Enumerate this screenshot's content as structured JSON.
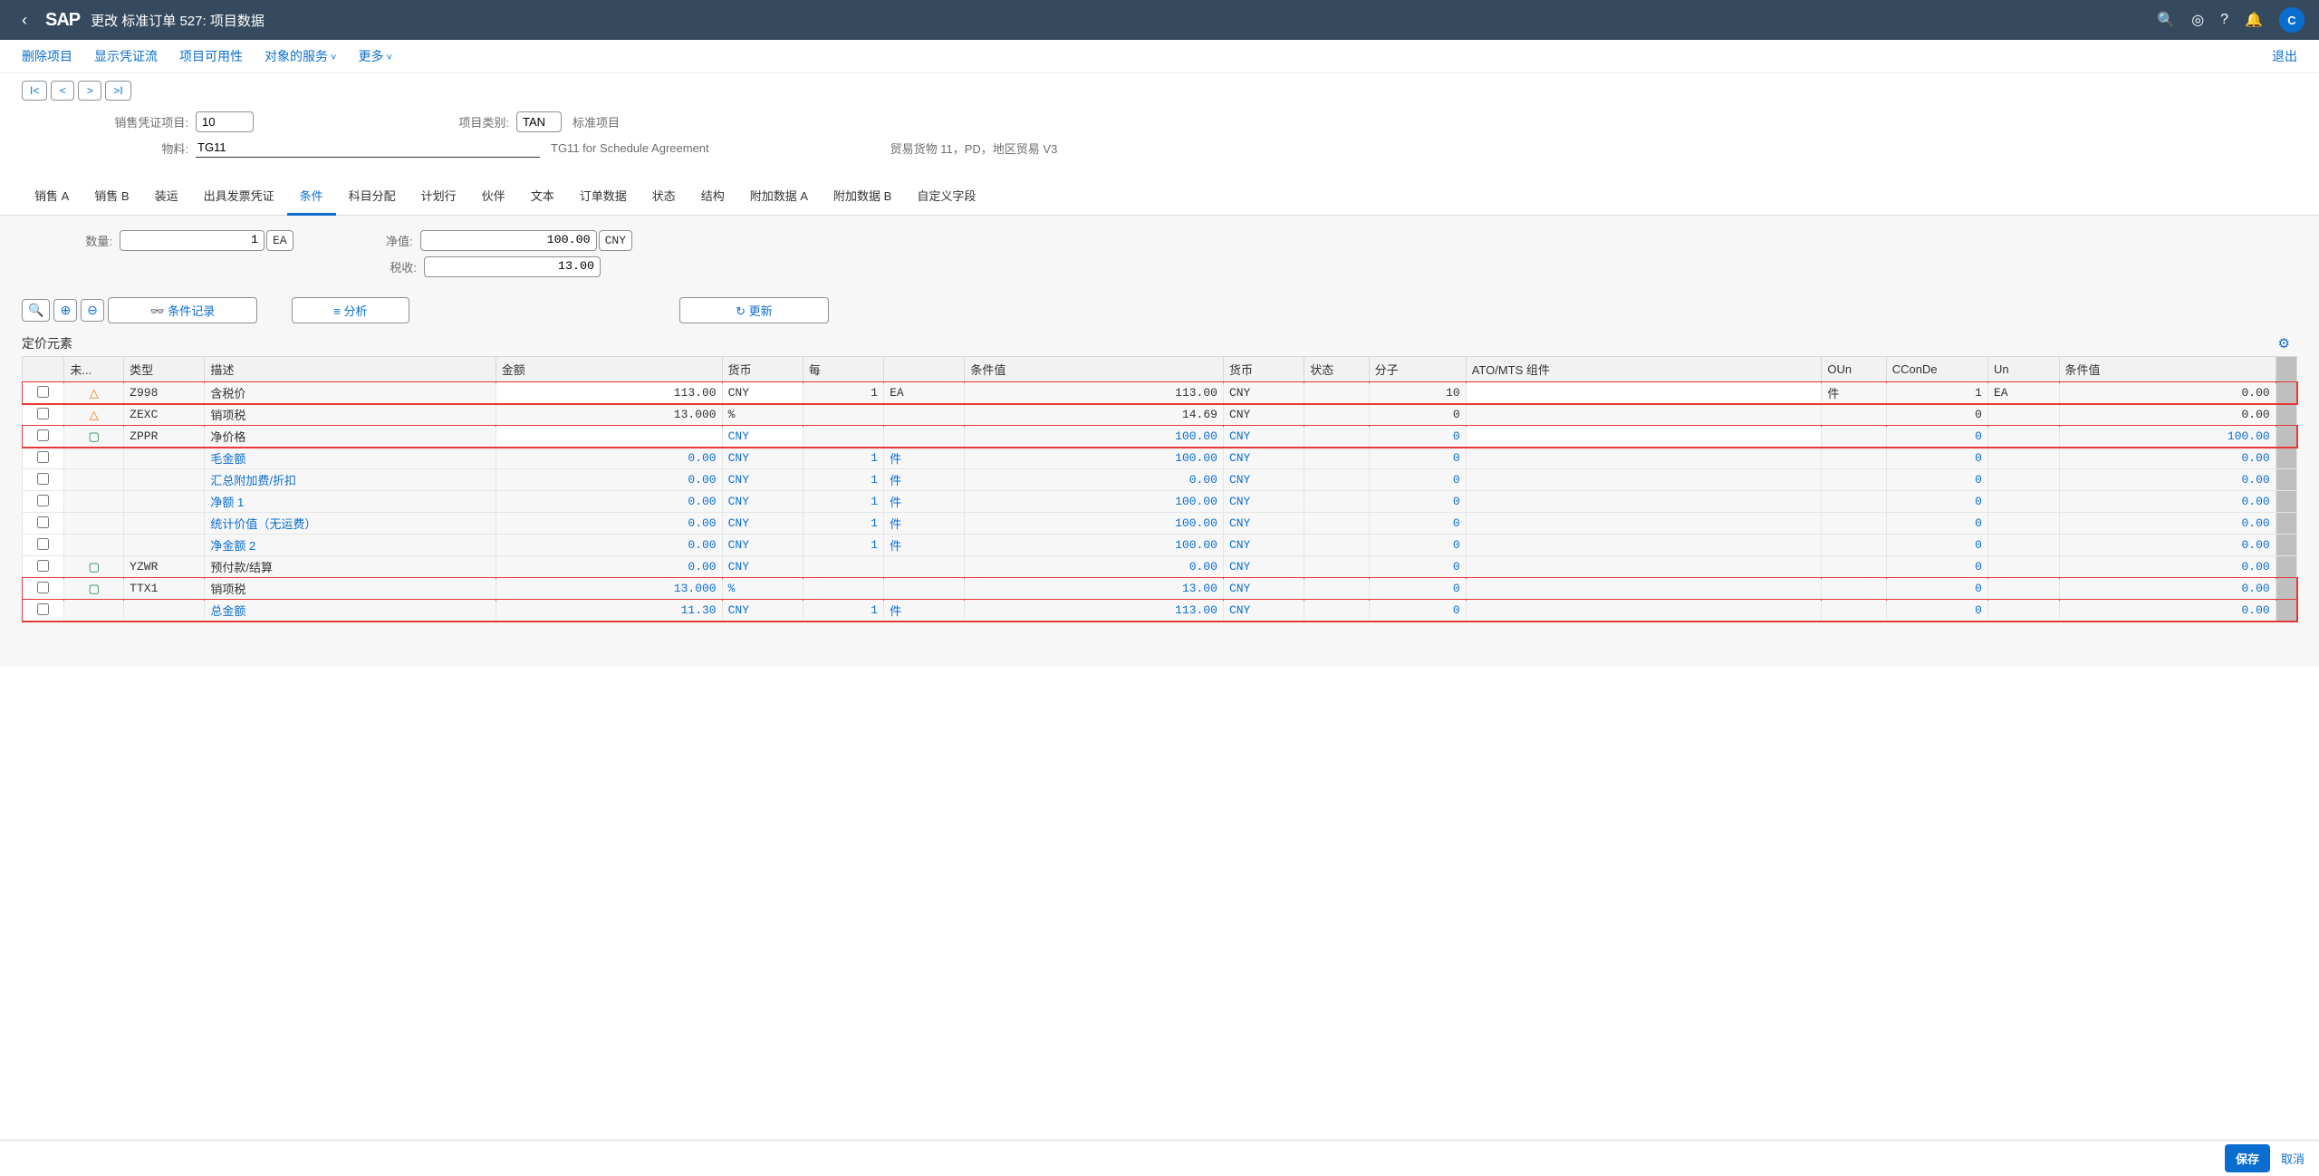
{
  "header": {
    "title": "更改 标准订单 527: 项目数据",
    "avatar": "C"
  },
  "toolbar": {
    "delete": "删除项目",
    "display_doc_flow": "显示凭证流",
    "item_availability": "项目可用性",
    "object_services": "对象的服务",
    "more": "更多",
    "exit": "退出"
  },
  "form": {
    "sales_doc_item_label": "销售凭证项目:",
    "sales_doc_item_value": "10",
    "item_category_label": "项目类别:",
    "item_category_value": "TAN",
    "item_category_text": "标准项目",
    "material_label": "物料:",
    "material_value": "TG11",
    "material_text": "TG11 for Schedule Agreement",
    "material_right": "贸易货物 11，PD，地区贸易 V3"
  },
  "tabs": [
    "销售 A",
    "销售 B",
    "装运",
    "出具发票凭证",
    "条件",
    "科目分配",
    "计划行",
    "伙伴",
    "文本",
    "订单数据",
    "状态",
    "结构",
    "附加数据 A",
    "附加数据 B",
    "自定义字段"
  ],
  "active_tab": 4,
  "condition_form": {
    "qty_label": "数量:",
    "qty_value": "1",
    "qty_unit": "EA",
    "net_label": "净值:",
    "net_value": "100.00",
    "net_unit": "CNY",
    "tax_label": "税收:",
    "tax_value": "13.00"
  },
  "actions": {
    "condition_record": "条件记录",
    "analyze": "分析",
    "update": "更新"
  },
  "section_title": "定价元素",
  "columns": [
    "",
    "未...",
    "类型",
    "描述",
    "金额",
    "货币",
    "每",
    "",
    "条件值",
    "货币",
    "状态",
    "分子",
    "ATO/MTS 组件",
    "OUn",
    "CConDe",
    "Un",
    "条件值"
  ],
  "rows": [
    {
      "hl": true,
      "status": "△",
      "status_color": "orange",
      "type": "Z998",
      "desc": "含税价",
      "amount": "113.00",
      "curr": "CNY",
      "per": "1",
      "peru": "EA",
      "val": "113.00",
      "curr2": "CNY",
      "num": "10",
      "oun": "件",
      "ccon": "1",
      "un": "EA",
      "val2": "0.00",
      "editable": true
    },
    {
      "hl": false,
      "status": "△",
      "status_color": "orange",
      "type": "ZEXC",
      "desc": "销项税",
      "amount": "13.000",
      "curr": "%",
      "per": "",
      "peru": "",
      "val": "14.69",
      "curr2": "CNY",
      "num": "0",
      "oun": "",
      "ccon": "0",
      "un": "",
      "val2": "0.00",
      "editable": false
    },
    {
      "hl": true,
      "status": "▢",
      "status_color": "green",
      "type": "ZPPR",
      "desc": "净价格",
      "amount": "",
      "curr": "CNY",
      "per": "",
      "peru": "",
      "val": "100.00",
      "curr2": "CNY",
      "num": "0",
      "oun": "",
      "ccon": "0",
      "un": "",
      "val2": "100.00",
      "editable": true,
      "link": true
    },
    {
      "hl": false,
      "status": "",
      "type": "",
      "desc": "毛金额",
      "amount": "0.00",
      "curr": "CNY",
      "per": "1",
      "peru": "件",
      "val": "100.00",
      "curr2": "CNY",
      "num": "0",
      "oun": "",
      "ccon": "0",
      "un": "",
      "val2": "0.00",
      "link": true
    },
    {
      "hl": false,
      "status": "",
      "type": "",
      "desc": "汇总附加费/折扣",
      "amount": "0.00",
      "curr": "CNY",
      "per": "1",
      "peru": "件",
      "val": "0.00",
      "curr2": "CNY",
      "num": "0",
      "oun": "",
      "ccon": "0",
      "un": "",
      "val2": "0.00",
      "link": true
    },
    {
      "hl": false,
      "status": "",
      "type": "",
      "desc": "净额 1",
      "amount": "0.00",
      "curr": "CNY",
      "per": "1",
      "peru": "件",
      "val": "100.00",
      "curr2": "CNY",
      "num": "0",
      "oun": "",
      "ccon": "0",
      "un": "",
      "val2": "0.00",
      "link": true
    },
    {
      "hl": false,
      "status": "",
      "type": "",
      "desc": "统计价值（无运费）",
      "amount": "0.00",
      "curr": "CNY",
      "per": "1",
      "peru": "件",
      "val": "100.00",
      "curr2": "CNY",
      "num": "0",
      "oun": "",
      "ccon": "0",
      "un": "",
      "val2": "0.00",
      "link": true
    },
    {
      "hl": false,
      "status": "",
      "type": "",
      "desc": "净金额 2",
      "amount": "0.00",
      "curr": "CNY",
      "per": "1",
      "peru": "件",
      "val": "100.00",
      "curr2": "CNY",
      "num": "0",
      "oun": "",
      "ccon": "0",
      "un": "",
      "val2": "0.00",
      "link": true
    },
    {
      "hl": false,
      "status": "▢",
      "status_color": "green",
      "type": "YZWR",
      "desc": "预付款/结算",
      "amount": "0.00",
      "curr": "CNY",
      "per": "",
      "peru": "",
      "val": "0.00",
      "curr2": "CNY",
      "num": "0",
      "oun": "",
      "ccon": "0",
      "un": "",
      "val2": "0.00",
      "link": true
    },
    {
      "hl": true,
      "status": "▢",
      "status_color": "green",
      "type": "TTX1",
      "desc": "销项税",
      "amount": "13.000",
      "curr": "%",
      "per": "",
      "peru": "",
      "val": "13.00",
      "curr2": "CNY",
      "num": "0",
      "oun": "",
      "ccon": "0",
      "un": "",
      "val2": "0.00",
      "link": true
    },
    {
      "hl": true,
      "status": "",
      "type": "",
      "desc": "总金额",
      "amount": "11.30",
      "curr": "CNY",
      "per": "1",
      "peru": "件",
      "val": "113.00",
      "curr2": "CNY",
      "num": "0",
      "oun": "",
      "ccon": "0",
      "un": "",
      "val2": "0.00",
      "link": true
    }
  ],
  "footer": {
    "save": "保存",
    "cancel": "取消"
  }
}
